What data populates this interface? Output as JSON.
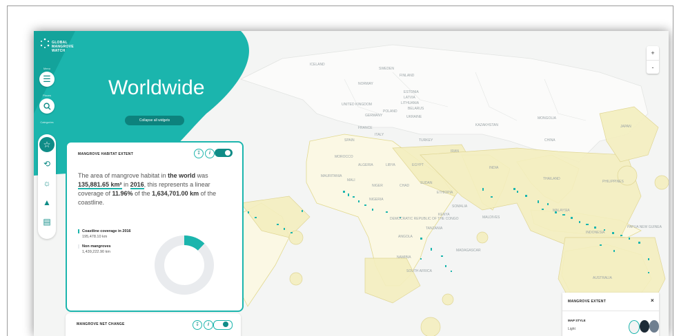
{
  "brand": {
    "logo_text": [
      "GLOBAL",
      "MANGROVE",
      "WATCH"
    ]
  },
  "rail": {
    "menu_label": "Menu",
    "places_label": "Places",
    "categories_label": "Categories"
  },
  "location": {
    "title": "Worldwide",
    "collapse_label": "Collapse all widgets"
  },
  "widget_extent": {
    "heading": "MANGROVE HABITAT EXTENT",
    "download_icon": "download-icon",
    "info_icon": "info-icon",
    "text_1": "The area of mangrove habitat in ",
    "text_world": "the world",
    "text_2": " was ",
    "area_value": "135,881.65 km²",
    "text_3": " in ",
    "year": "2016",
    "text_4": ", this represents a linear coverage of ",
    "percent": "11.96%",
    "text_5": " of the ",
    "coast_total": "1,634,701.00 km",
    "text_6": " of the coastline.",
    "legend": [
      {
        "title": "Coastline coverage in 2016",
        "value": "195,478.10 km",
        "color": "#1bb5ad"
      },
      {
        "title": "Non mangroves",
        "value": "1,439,222.90 km",
        "color": "#e9ebee"
      }
    ],
    "coverage_fraction": 0.1196
  },
  "widget_net_change": {
    "heading": "MANGROVE NET CHANGE"
  },
  "zoom": {
    "in": "+",
    "out": "-"
  },
  "map_panel": {
    "heading": "MANGROVE EXTENT",
    "close": "×",
    "style_label": "MAP STYLE",
    "style_value": "Light",
    "swatch_colors": [
      "#f4f4f4",
      "#1d2a36",
      "#6f7f90"
    ]
  },
  "map_labels": [
    "ICELAND",
    "SWEDEN",
    "FINLAND",
    "NORWAY",
    "ESTONIA",
    "LATVIA",
    "LITHUANIA",
    "UNITED KINGDOM",
    "BELARUS",
    "POLAND",
    "GERMANY",
    "UKRAINE",
    "FRANCE",
    "ITALY",
    "SPAIN",
    "TURKEY",
    "KAZAKHSTAN",
    "MONGOLIA",
    "CHINA",
    "IRAN",
    "INDIA",
    "MOROCCO",
    "ALGERIA",
    "LIBYA",
    "EGYPT",
    "NIGER",
    "SUDAN",
    "CHAD",
    "NIGERIA",
    "ETHIOPIA",
    "SOMALIA",
    "KENYA",
    "TANZANIA",
    "ANGOLA",
    "NAMIBIA",
    "MADAGASCAR",
    "MALI",
    "MAURITANIA",
    "DEMOCRATIC REPUBLIC OF THE CONGO",
    "SOUTH AFRICA",
    "INDONESIA",
    "AUSTRALIA",
    "PAPUA NEW GUINEA",
    "JAPAN",
    "PHILIPPINES",
    "MALAYSIA",
    "THAILAND",
    "MALDIVES"
  ],
  "colors": {
    "teal": "#1bb5ad",
    "teal_dark": "#0f8c87",
    "land": "#f6f0c8",
    "eez": "#e3d98a"
  }
}
